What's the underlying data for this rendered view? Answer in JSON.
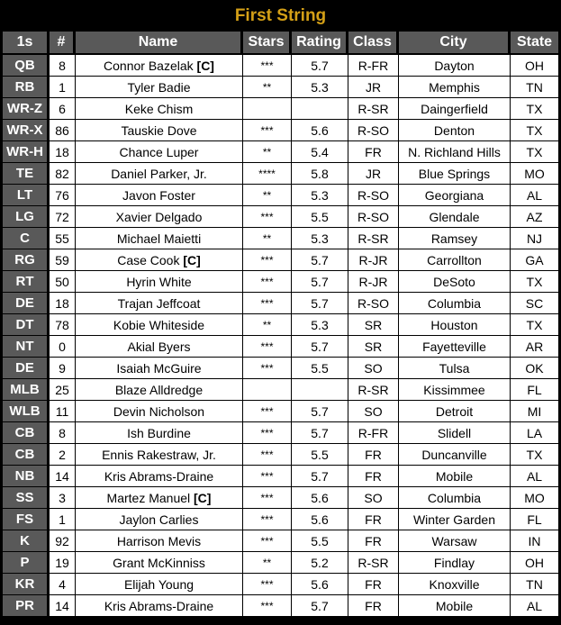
{
  "title": "First String",
  "columns": [
    "1s",
    "#",
    "Name",
    "Stars",
    "Rating",
    "Class",
    "City",
    "State"
  ],
  "captain_marker": "[C]",
  "colors": {
    "title": "#d4a017",
    "header_bg": "#595959",
    "header_text": "#ffffff",
    "cell_bg": "#ffffff",
    "background": "#000000"
  },
  "rows": [
    {
      "pos": "QB",
      "num": "8",
      "name": "Connor Bazelak",
      "captain": true,
      "stars": "***",
      "rating": "5.7",
      "class": "R-FR",
      "city": "Dayton",
      "state": "OH"
    },
    {
      "pos": "RB",
      "num": "1",
      "name": "Tyler Badie",
      "captain": false,
      "stars": "**",
      "rating": "5.3",
      "class": "JR",
      "city": "Memphis",
      "state": "TN"
    },
    {
      "pos": "WR-Z",
      "num": "6",
      "name": "Keke Chism",
      "captain": false,
      "stars": "",
      "rating": "",
      "class": "R-SR",
      "city": "Daingerfield",
      "state": "TX"
    },
    {
      "pos": "WR-X",
      "num": "86",
      "name": "Tauskie Dove",
      "captain": false,
      "stars": "***",
      "rating": "5.6",
      "class": "R-SO",
      "city": "Denton",
      "state": "TX"
    },
    {
      "pos": "WR-H",
      "num": "18",
      "name": "Chance Luper",
      "captain": false,
      "stars": "**",
      "rating": "5.4",
      "class": "FR",
      "city": "N. Richland Hills",
      "state": "TX"
    },
    {
      "pos": "TE",
      "num": "82",
      "name": "Daniel Parker, Jr.",
      "captain": false,
      "stars": "****",
      "rating": "5.8",
      "class": "JR",
      "city": "Blue Springs",
      "state": "MO"
    },
    {
      "pos": "LT",
      "num": "76",
      "name": "Javon Foster",
      "captain": false,
      "stars": "**",
      "rating": "5.3",
      "class": "R-SO",
      "city": "Georgiana",
      "state": "AL"
    },
    {
      "pos": "LG",
      "num": "72",
      "name": "Xavier Delgado",
      "captain": false,
      "stars": "***",
      "rating": "5.5",
      "class": "R-SO",
      "city": "Glendale",
      "state": "AZ"
    },
    {
      "pos": "C",
      "num": "55",
      "name": "Michael Maietti",
      "captain": false,
      "stars": "**",
      "rating": "5.3",
      "class": "R-SR",
      "city": "Ramsey",
      "state": "NJ"
    },
    {
      "pos": "RG",
      "num": "59",
      "name": "Case Cook",
      "captain": true,
      "stars": "***",
      "rating": "5.7",
      "class": "R-JR",
      "city": "Carrollton",
      "state": "GA"
    },
    {
      "pos": "RT",
      "num": "50",
      "name": "Hyrin White",
      "captain": false,
      "stars": "***",
      "rating": "5.7",
      "class": "R-JR",
      "city": "DeSoto",
      "state": "TX"
    },
    {
      "pos": "DE",
      "num": "18",
      "name": "Trajan Jeffcoat",
      "captain": false,
      "stars": "***",
      "rating": "5.7",
      "class": "R-SO",
      "city": "Columbia",
      "state": "SC"
    },
    {
      "pos": "DT",
      "num": "78",
      "name": "Kobie Whiteside",
      "captain": false,
      "stars": "**",
      "rating": "5.3",
      "class": "SR",
      "city": "Houston",
      "state": "TX"
    },
    {
      "pos": "NT",
      "num": "0",
      "name": "Akial Byers",
      "captain": false,
      "stars": "***",
      "rating": "5.7",
      "class": "SR",
      "city": "Fayetteville",
      "state": "AR"
    },
    {
      "pos": "DE",
      "num": "9",
      "name": "Isaiah McGuire",
      "captain": false,
      "stars": "***",
      "rating": "5.5",
      "class": "SO",
      "city": "Tulsa",
      "state": "OK"
    },
    {
      "pos": "MLB",
      "num": "25",
      "name": "Blaze Alldredge",
      "captain": false,
      "stars": "",
      "rating": "",
      "class": "R-SR",
      "city": "Kissimmee",
      "state": "FL"
    },
    {
      "pos": "WLB",
      "num": "11",
      "name": "Devin Nicholson",
      "captain": false,
      "stars": "***",
      "rating": "5.7",
      "class": "SO",
      "city": "Detroit",
      "state": "MI"
    },
    {
      "pos": "CB",
      "num": "8",
      "name": "Ish Burdine",
      "captain": false,
      "stars": "***",
      "rating": "5.7",
      "class": "R-FR",
      "city": "Slidell",
      "state": "LA"
    },
    {
      "pos": "CB",
      "num": "2",
      "name": "Ennis Rakestraw, Jr.",
      "captain": false,
      "stars": "***",
      "rating": "5.5",
      "class": "FR",
      "city": "Duncanville",
      "state": "TX"
    },
    {
      "pos": "NB",
      "num": "14",
      "name": "Kris Abrams-Draine",
      "captain": false,
      "stars": "***",
      "rating": "5.7",
      "class": "FR",
      "city": "Mobile",
      "state": "AL"
    },
    {
      "pos": "SS",
      "num": "3",
      "name": "Martez Manuel",
      "captain": true,
      "stars": "***",
      "rating": "5.6",
      "class": "SO",
      "city": "Columbia",
      "state": "MO"
    },
    {
      "pos": "FS",
      "num": "1",
      "name": "Jaylon Carlies",
      "captain": false,
      "stars": "***",
      "rating": "5.6",
      "class": "FR",
      "city": "Winter Garden",
      "state": "FL"
    },
    {
      "pos": "K",
      "num": "92",
      "name": "Harrison Mevis",
      "captain": false,
      "stars": "***",
      "rating": "5.5",
      "class": "FR",
      "city": "Warsaw",
      "state": "IN"
    },
    {
      "pos": "P",
      "num": "19",
      "name": "Grant McKinniss",
      "captain": false,
      "stars": "**",
      "rating": "5.2",
      "class": "R-SR",
      "city": "Findlay",
      "state": "OH"
    },
    {
      "pos": "KR",
      "num": "4",
      "name": "Elijah Young",
      "captain": false,
      "stars": "***",
      "rating": "5.6",
      "class": "FR",
      "city": "Knoxville",
      "state": "TN"
    },
    {
      "pos": "PR",
      "num": "14",
      "name": "Kris Abrams-Draine",
      "captain": false,
      "stars": "***",
      "rating": "5.7",
      "class": "FR",
      "city": "Mobile",
      "state": "AL"
    }
  ]
}
